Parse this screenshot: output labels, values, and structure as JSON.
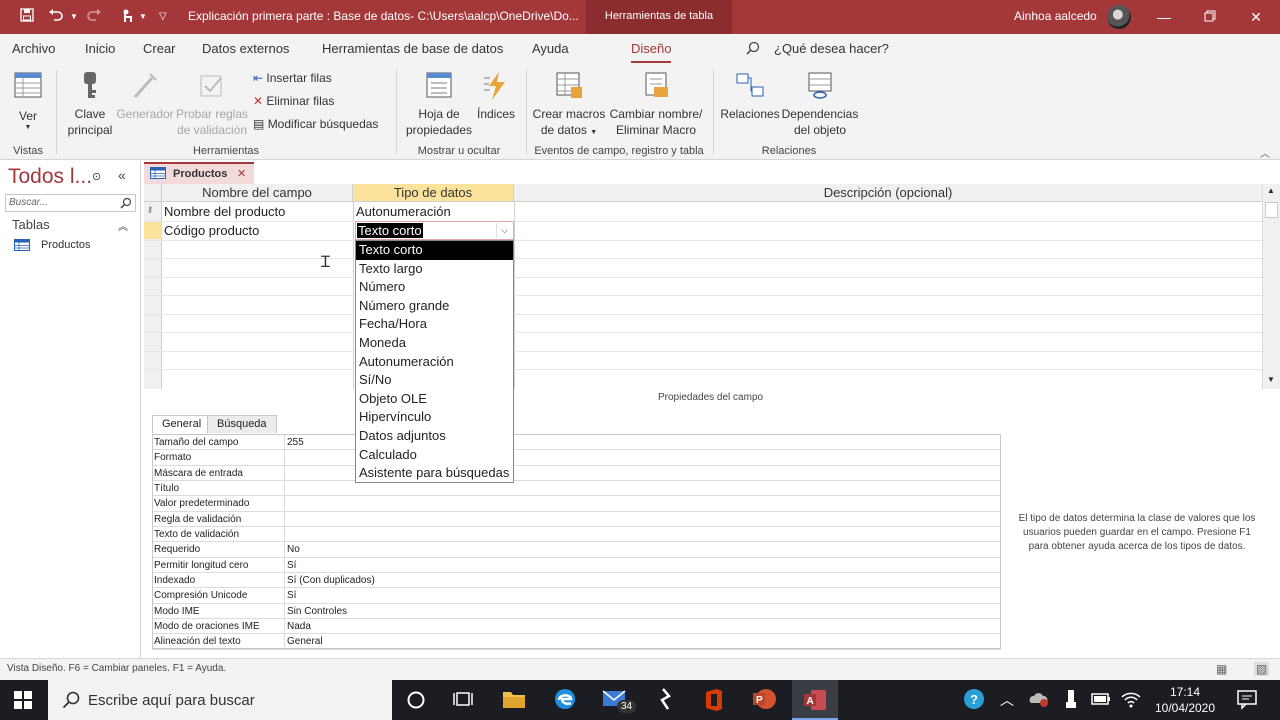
{
  "titlebar": {
    "doc_title": "Explicación primera parte : Base de datos- C:\\Users\\aalcp\\OneDrive\\Do...",
    "context_tab": "Herramientas de tabla",
    "user": "Ainhoa aalcedo",
    "accent": "#a4373a"
  },
  "ribbon_tabs": [
    "Archivo",
    "Inicio",
    "Crear",
    "Datos externos",
    "Herramientas de base de datos",
    "Ayuda",
    "Diseño"
  ],
  "active_tab": "Diseño",
  "tell_me": "¿Qué desea hacer?",
  "ribbon": {
    "ver": "Ver",
    "vistas": "Vistas",
    "clave_principal_1": "Clave",
    "clave_principal_2": "principal",
    "generador": "Generador",
    "probar_reglas_1": "Probar reglas",
    "probar_reglas_2": "de validación",
    "insertar_filas": "Insertar filas",
    "eliminar_filas": "Eliminar filas",
    "modificar_busquedas": "Modificar búsquedas",
    "herramientas": "Herramientas",
    "hoja_prop_1": "Hoja de",
    "hoja_prop_2": "propiedades",
    "indices": "Índices",
    "mostrar_ocultar": "Mostrar u ocultar",
    "crear_macros_1": "Crear macros",
    "crear_macros_2": "de datos",
    "cambiar_nombre_1": "Cambiar nombre/",
    "cambiar_nombre_2": "Eliminar Macro",
    "eventos": "Eventos de campo, registro y tabla",
    "relaciones": "Relaciones",
    "dependencias_1": "Dependencias",
    "dependencias_2": "del objeto",
    "relaciones_grp": "Relaciones"
  },
  "navpane": {
    "title": "Todos l...",
    "search_placeholder": "Buscar...",
    "section": "Tablas",
    "items": [
      "Productos"
    ]
  },
  "doc_tab": "Productos",
  "grid": {
    "headers": [
      "Nombre del campo",
      "Tipo de datos",
      "Descripción (opcional)"
    ],
    "rows": [
      {
        "field": "Nombre del producto",
        "type": "Autonumeración"
      },
      {
        "field": "Código producto",
        "type": "Texto corto"
      }
    ]
  },
  "dropdown": {
    "options": [
      "Texto corto",
      "Texto largo",
      "Número",
      "Número grande",
      "Fecha/Hora",
      "Moneda",
      "Autonumeración",
      "Sí/No",
      "Objeto OLE",
      "Hipervínculo",
      "Datos adjuntos",
      "Calculado",
      "Asistente para búsquedas"
    ],
    "selected": "Texto corto"
  },
  "properties": {
    "title": "Propiedades del campo",
    "tabs": [
      "General",
      "Búsqueda"
    ],
    "rows": [
      {
        "label": "Tamaño del campo",
        "value": "255"
      },
      {
        "label": "Formato",
        "value": ""
      },
      {
        "label": "Máscara de entrada",
        "value": ""
      },
      {
        "label": "Título",
        "value": ""
      },
      {
        "label": "Valor predeterminado",
        "value": ""
      },
      {
        "label": "Regla de validación",
        "value": ""
      },
      {
        "label": "Texto de validación",
        "value": ""
      },
      {
        "label": "Requerido",
        "value": "No"
      },
      {
        "label": "Permitir longitud cero",
        "value": "Sí"
      },
      {
        "label": "Indexado",
        "value": "Sí (Con duplicados)"
      },
      {
        "label": "Compresión Unicode",
        "value": "Sí"
      },
      {
        "label": "Modo IME",
        "value": "Sin Controles"
      },
      {
        "label": "Modo de oraciones IME",
        "value": "Nada"
      },
      {
        "label": "Alineación del texto",
        "value": "General"
      }
    ],
    "help": "El tipo de datos determina la clase de valores que los usuarios pueden guardar en el campo. Presione F1 para obtener ayuda acerca de los tipos de datos."
  },
  "statusbar": "Vista Diseño.  F6 = Cambiar paneles.  F1 = Ayuda.",
  "taskbar": {
    "search": "Escribe aquí para buscar",
    "mail_badge": "34",
    "time": "17:14",
    "date": "10/04/2020"
  }
}
